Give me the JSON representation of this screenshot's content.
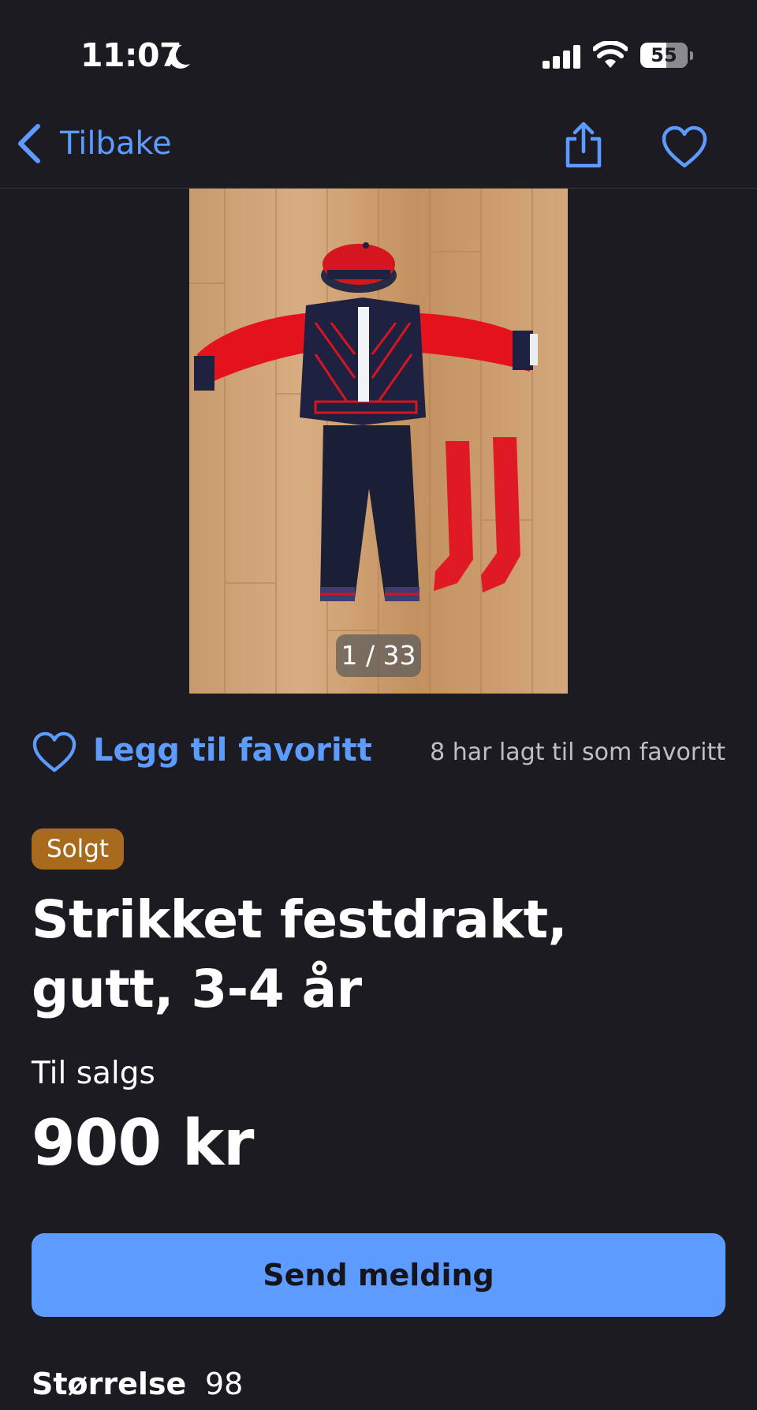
{
  "status_bar": {
    "time": "11:07",
    "battery": "55",
    "battery_level": 0.55,
    "icons": [
      "moon-icon",
      "signal-icon",
      "wifi-icon",
      "battery-icon"
    ]
  },
  "nav": {
    "back_label": "Tilbake",
    "icons": [
      "back-chevron-icon",
      "share-icon",
      "heart-icon"
    ]
  },
  "gallery": {
    "counter": "1 / 33"
  },
  "favorite": {
    "label": "Legg til favoritt",
    "count_text": "8 har lagt til som favoritt"
  },
  "listing": {
    "status_badge": "Solgt",
    "title": "Strikket festdrakt, gutt, 3-4 år",
    "sale_type": "Til salgs",
    "price": "900 kr",
    "send_button": "Send melding",
    "size_label": "Størrelse",
    "size_value": "98"
  },
  "colors": {
    "background": "#1b1b21",
    "accent": "#5d9bff",
    "sold_badge": "#a86a1c",
    "text": "#ffffff",
    "muted_text": "#bfbfc5"
  }
}
